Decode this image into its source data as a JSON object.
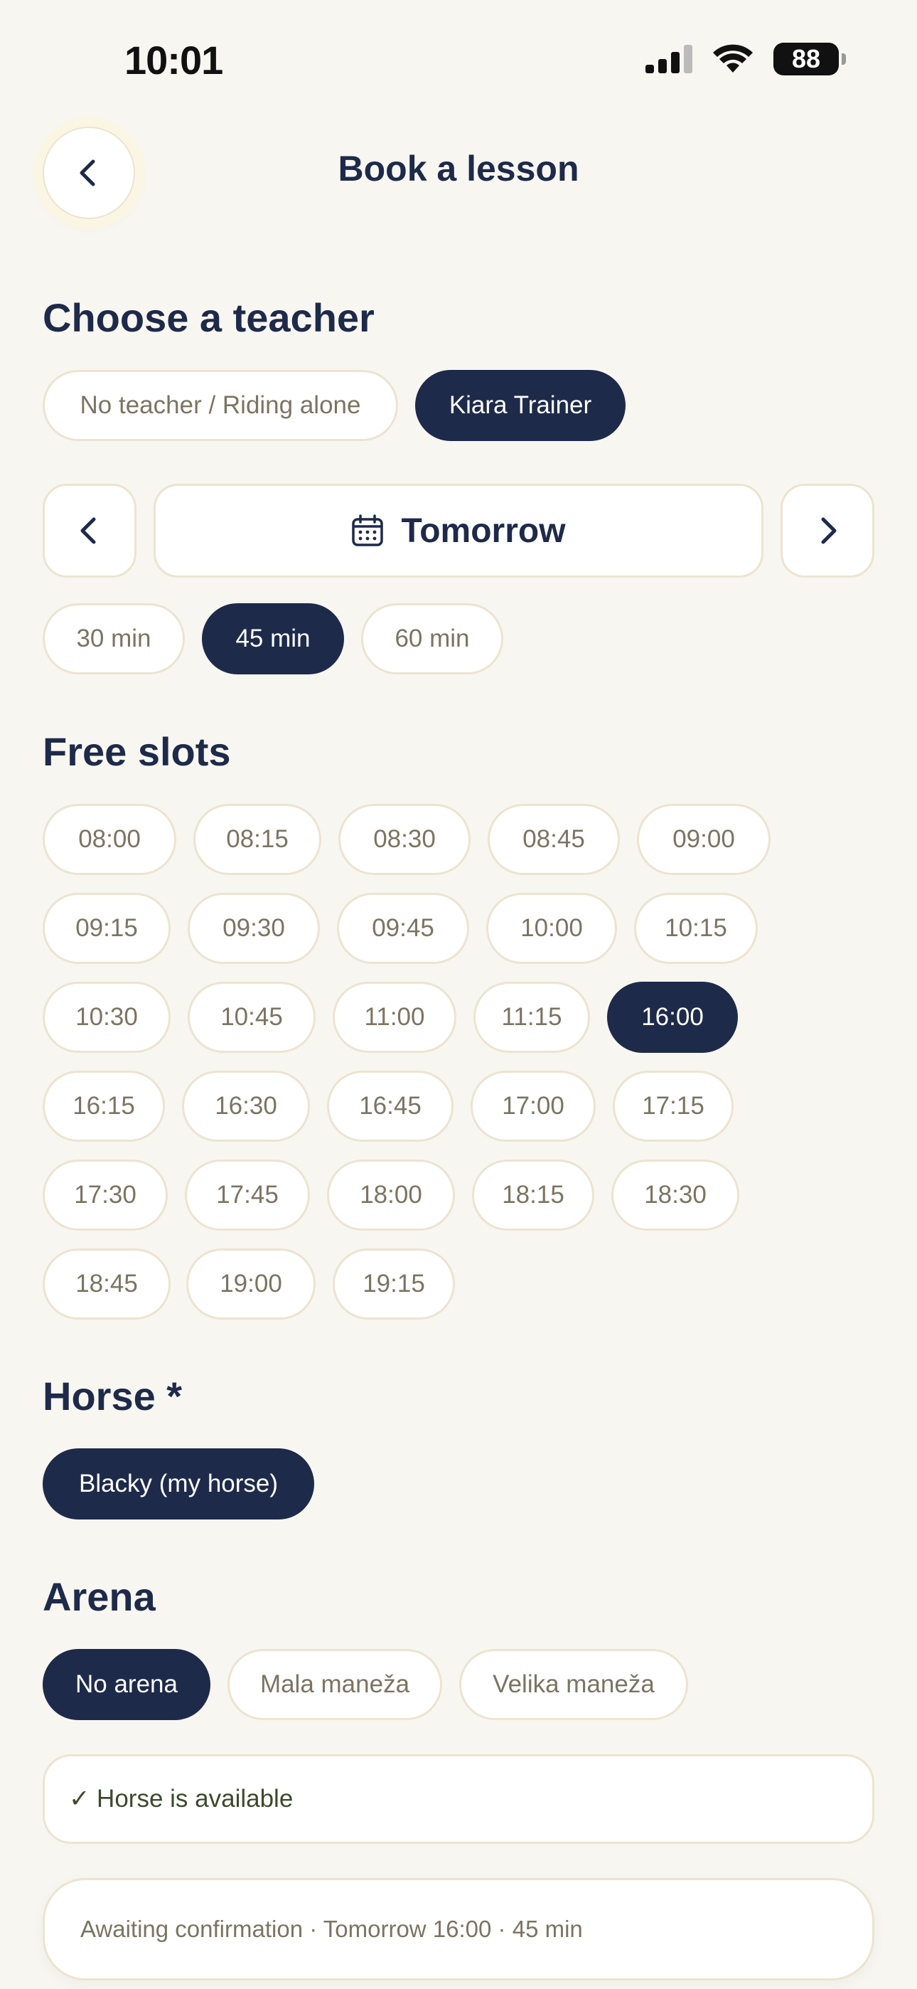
{
  "status_bar": {
    "time": "10:01",
    "battery": "88"
  },
  "header": {
    "title": "Book a lesson"
  },
  "teacher": {
    "title": "Choose a teacher",
    "options": [
      "No teacher / Riding alone",
      "Kiara Trainer"
    ],
    "selected": 1
  },
  "date": {
    "label": "Tomorrow"
  },
  "durations": {
    "options": [
      "30 min",
      "45 min",
      "60 min"
    ],
    "selected": 1
  },
  "slots": {
    "title": "Free slots",
    "rows": [
      [
        "08:00",
        "08:15",
        "08:30",
        "08:45",
        "09:00"
      ],
      [
        "09:15",
        "09:30",
        "09:45",
        "10:00",
        "10:15"
      ],
      [
        "10:30",
        "10:45",
        "11:00",
        "11:15",
        "16:00"
      ],
      [
        "16:15",
        "16:30",
        "16:45",
        "17:00",
        "17:15"
      ],
      [
        "17:30",
        "17:45",
        "18:00",
        "18:15",
        "18:30"
      ],
      [
        "18:45",
        "19:00",
        "19:15"
      ]
    ],
    "selected": "16:00"
  },
  "horse": {
    "title": "Horse *",
    "options": [
      "Blacky (my horse)"
    ],
    "selected": 0
  },
  "arena": {
    "title": "Arena",
    "options": [
      "No arena",
      "Mala maneža",
      "Velika maneža"
    ],
    "selected": 0
  },
  "availability": {
    "text": "✓ Horse is available"
  },
  "summary": {
    "text": "Awaiting confirmation · Tomorrow 16:00 · 45 min"
  },
  "colors": {
    "primary": "#1e2a4a",
    "background": "#f8f6f1",
    "border": "#ece4cf",
    "muted_text": "#7b7462"
  }
}
